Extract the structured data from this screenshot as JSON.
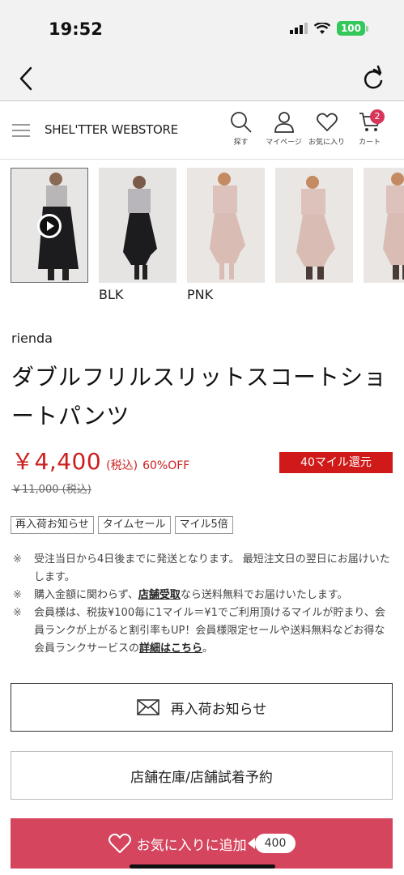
{
  "status": {
    "time": "19:52",
    "battery": "100"
  },
  "header": {
    "logo": "SHEL'TTER WEBSTORE",
    "icons": [
      {
        "name": "search-icon",
        "label": "探す"
      },
      {
        "name": "user-icon",
        "label": "マイページ"
      },
      {
        "name": "heart-icon",
        "label": "お気に入り"
      },
      {
        "name": "cart-icon",
        "label": "カート"
      }
    ],
    "cart_count": "2"
  },
  "thumbnails": {
    "labels": [
      "BLK",
      "PNK"
    ],
    "colors": {
      "black": "#1c1c1e",
      "pink": "#d9bcb4"
    }
  },
  "product": {
    "brand": "rienda",
    "title": "ダブルフリルスリットスコートショートパンツ",
    "price": "￥4,400",
    "tax": "(税込)",
    "discount": "60%OFF",
    "original_price": "￥11,000 (税込)",
    "miles": "40マイル還元"
  },
  "tags": [
    "再入荷お知らせ",
    "タイムセール",
    "マイル5倍"
  ],
  "notes": {
    "mark": "※",
    "n1": "受注当日から4日後までに発送となります。 最短注文日の翌日にお届けいたします。",
    "n2_pre": "購入金額に関わらず、",
    "n2_link": "店舗受取",
    "n2_post": "なら送料無料でお届けいたします。",
    "n3_pre": "会員様は、税抜¥100毎に1マイル＝¥1でご利用頂けるマイルが貯まり、会員ランクが上がると割引率もUP！会員様限定セールや送料無料などお得な会員ランクサービスの",
    "n3_link": "詳細はこちら",
    "n3_post": "。"
  },
  "buttons": {
    "restock": "再入荷お知らせ",
    "store": "店舗在庫/店舗試着予約",
    "favorite": "お気に入りに追加",
    "favorite_count": "400"
  },
  "colors": {
    "accent": "#d6455e",
    "price_red": "#cc1f1f",
    "mile_red": "#d01a1a"
  }
}
